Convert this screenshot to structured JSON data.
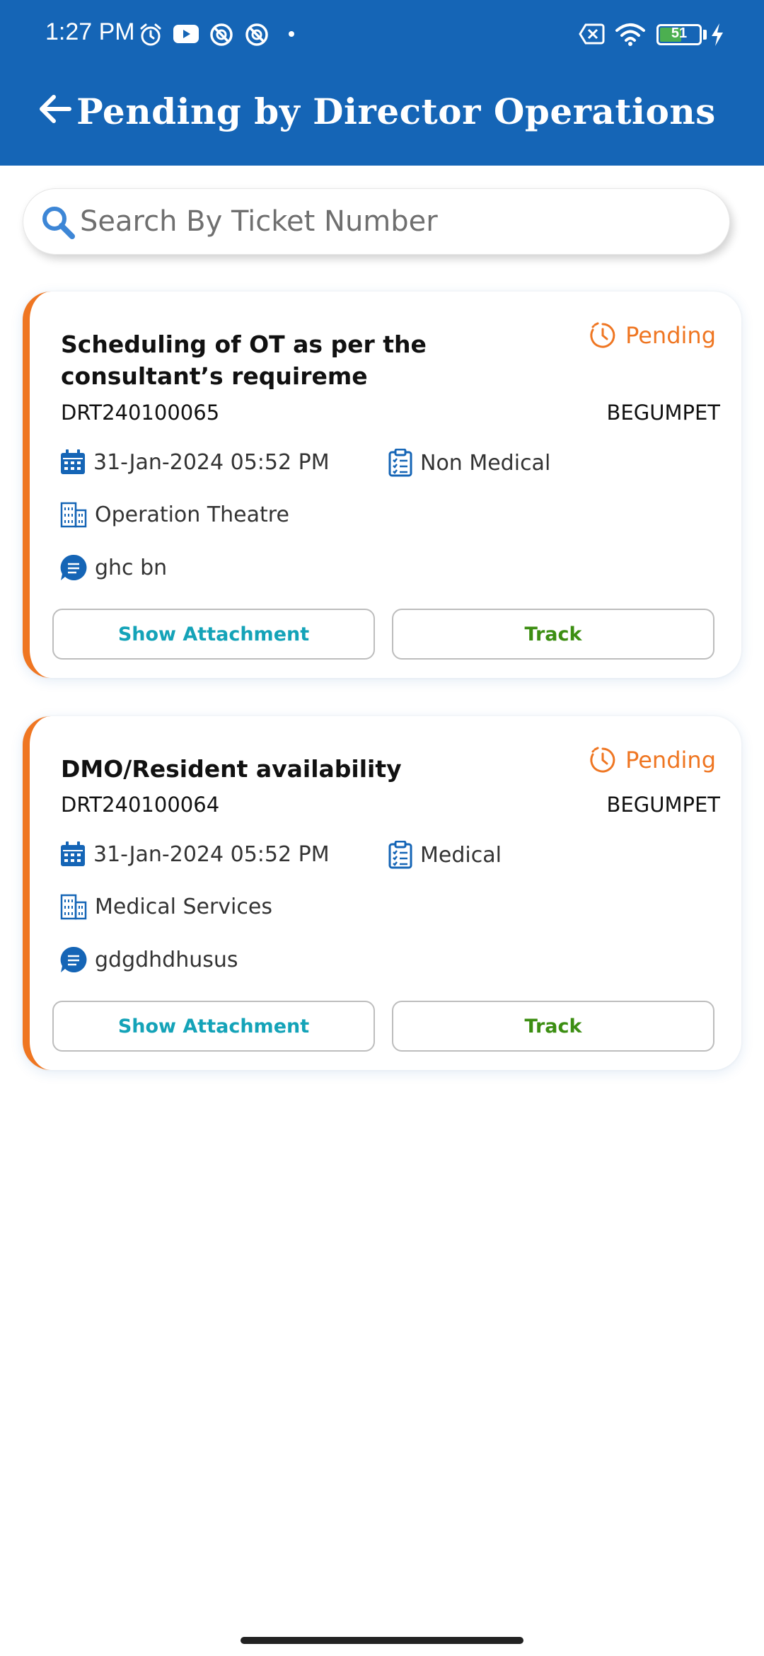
{
  "status_bar": {
    "time": "1:27 PM",
    "battery": "51",
    "battery_level": 0.51,
    "icons": [
      "alarm-icon",
      "youtube-icon",
      "no-disturb-icon",
      "no-disturb-icon",
      "dot-icon",
      "sim-off-icon",
      "wifi-icon",
      "battery-icon",
      "charging-icon"
    ]
  },
  "header": {
    "title": "Pending by Director Operations",
    "back_icon": "arrow-left-icon"
  },
  "search": {
    "placeholder": "Search By Ticket Number",
    "value": ""
  },
  "colors": {
    "header": "#1565b6",
    "accent": "#ef7622",
    "attachment": "#14a3b8",
    "track": "#3c8e12",
    "icon": "#1565b6"
  },
  "tickets": [
    {
      "title": "Scheduling of OT as per the consultant’s requireme",
      "status": "Pending",
      "ticket_no": "DRT240100065",
      "location": "BEGUMPET",
      "date": "31-Jan-2024 05:52 PM",
      "category": "Non Medical",
      "department": "Operation Theatre",
      "comment": "ghc bn",
      "attachment_label": "Show Attachment",
      "track_label": "Track"
    },
    {
      "title": "DMO/Resident availability",
      "status": "Pending",
      "ticket_no": "DRT240100064",
      "location": "BEGUMPET",
      "date": "31-Jan-2024 05:52 PM",
      "category": "Medical",
      "department": "Medical Services",
      "comment": "gdgdhdhusus",
      "attachment_label": "Show Attachment",
      "track_label": "Track"
    }
  ]
}
